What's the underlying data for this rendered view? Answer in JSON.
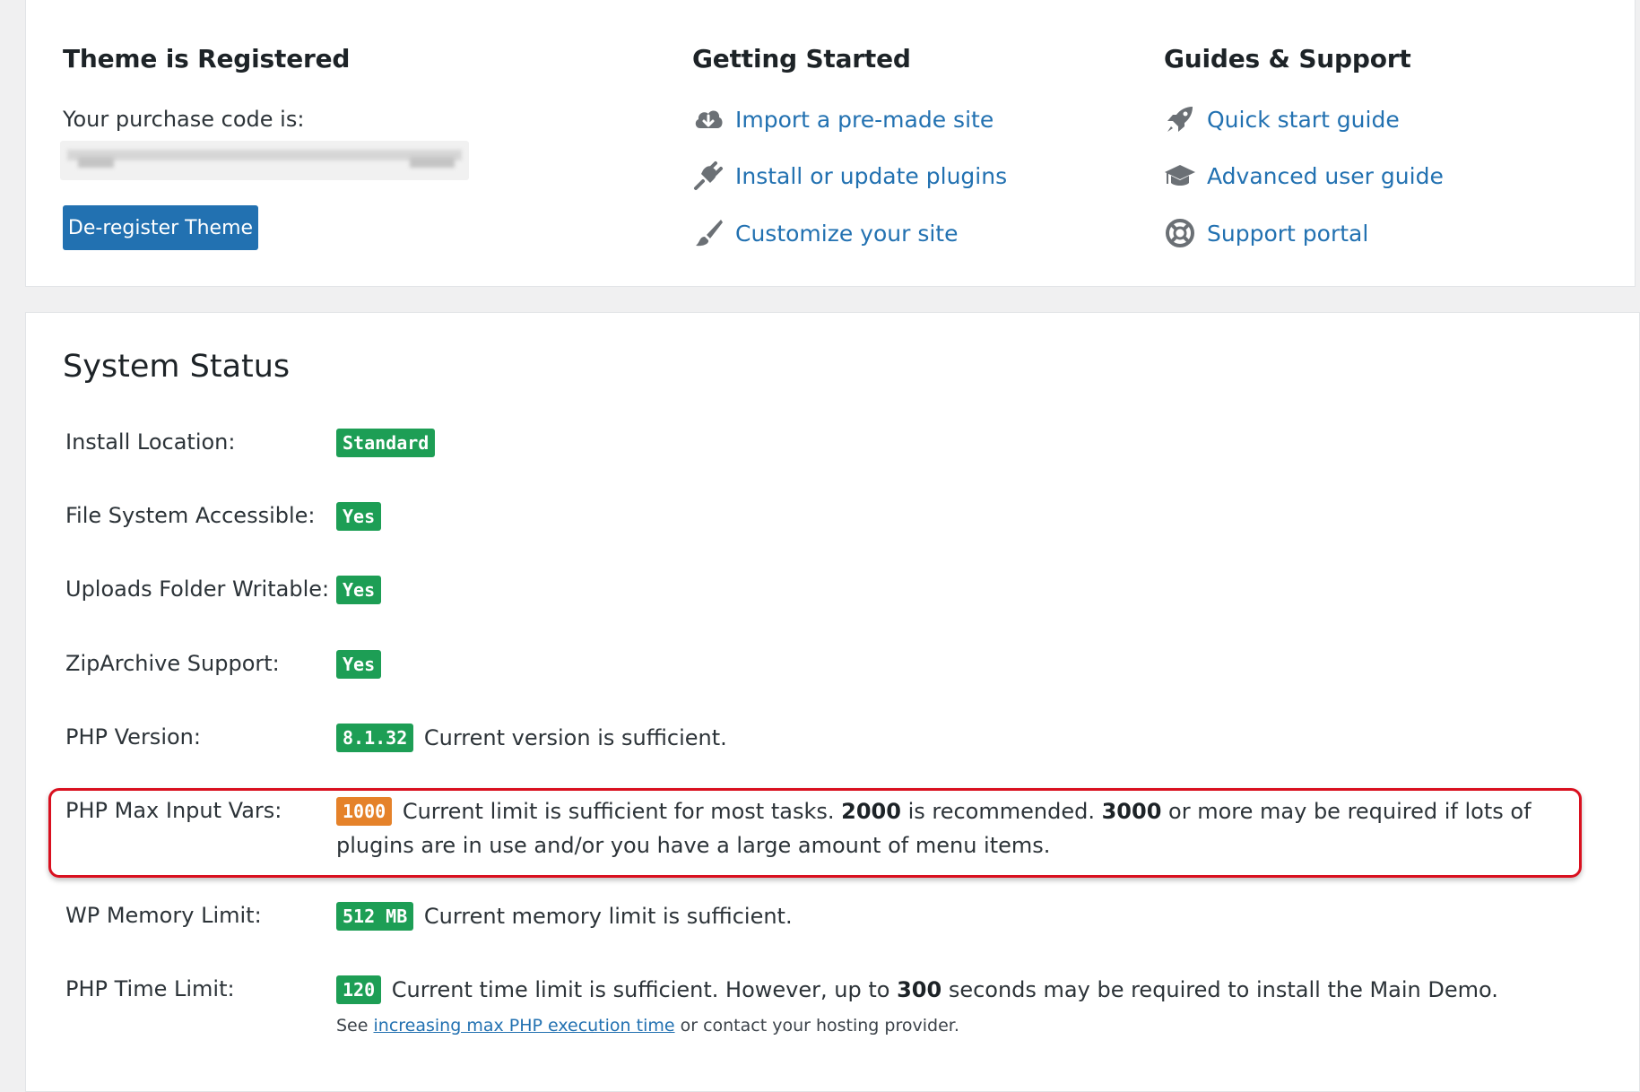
{
  "registration": {
    "title": "Theme is Registered",
    "purchase_label": "Your purchase code is:",
    "deregister_label": "De-register Theme"
  },
  "getting_started": {
    "title": "Getting Started",
    "links": [
      {
        "label": "Import a pre-made site",
        "icon": "cloud-download-icon"
      },
      {
        "label": "Install or update plugins",
        "icon": "plug-icon"
      },
      {
        "label": "Customize your site",
        "icon": "paintbrush-icon"
      }
    ]
  },
  "guides": {
    "title": "Guides & Support",
    "links": [
      {
        "label": "Quick start guide",
        "icon": "rocket-icon"
      },
      {
        "label": "Advanced user guide",
        "icon": "graduation-cap-icon"
      },
      {
        "label": "Support portal",
        "icon": "lifebuoy-icon"
      }
    ]
  },
  "status": {
    "title": "System Status",
    "rows": [
      {
        "label": "Install Location:",
        "badge": "Standard",
        "badge_color": "#1d9e55",
        "text": ""
      },
      {
        "label": "File System Accessible:",
        "badge": "Yes",
        "badge_color": "#1d9e55",
        "text": ""
      },
      {
        "label": "Uploads Folder Writable:",
        "badge": "Yes",
        "badge_color": "#1d9e55",
        "text": ""
      },
      {
        "label": "ZipArchive Support:",
        "badge": "Yes",
        "badge_color": "#1d9e55",
        "text": ""
      },
      {
        "label": "PHP Version:",
        "badge": "8.1.32",
        "badge_color": "#1d9e55",
        "text": "Current version is sufficient."
      },
      {
        "label": "PHP Max Input Vars:",
        "badge": "1000",
        "badge_color": "#e5822a",
        "text_a": "Current limit is sufficient for most tasks.",
        "bold_a": "2000",
        "text_b": "is recommended.",
        "bold_b": "3000",
        "text_c": "or more may be required if lots of plugins are in use and/or you have a large amount of menu items."
      },
      {
        "label": "WP Memory Limit:",
        "badge": "512 MB",
        "badge_color": "#1d9e55",
        "text": "Current memory limit is sufficient."
      },
      {
        "label": "PHP Time Limit:",
        "badge": "120",
        "badge_color": "#1d9e55",
        "text_a": "Current time limit is sufficient. However, up to",
        "bold_a": "300",
        "text_b": "seconds may be required to install the Main Demo.",
        "note_prefix": "See",
        "note_link": "increasing max PHP execution time",
        "note_suffix": "or contact your hosting provider."
      }
    ]
  },
  "colors": {
    "link": "#2271b1",
    "badge_ok": "#1d9e55",
    "badge_warn": "#e5822a",
    "highlight": "#d9101f"
  }
}
